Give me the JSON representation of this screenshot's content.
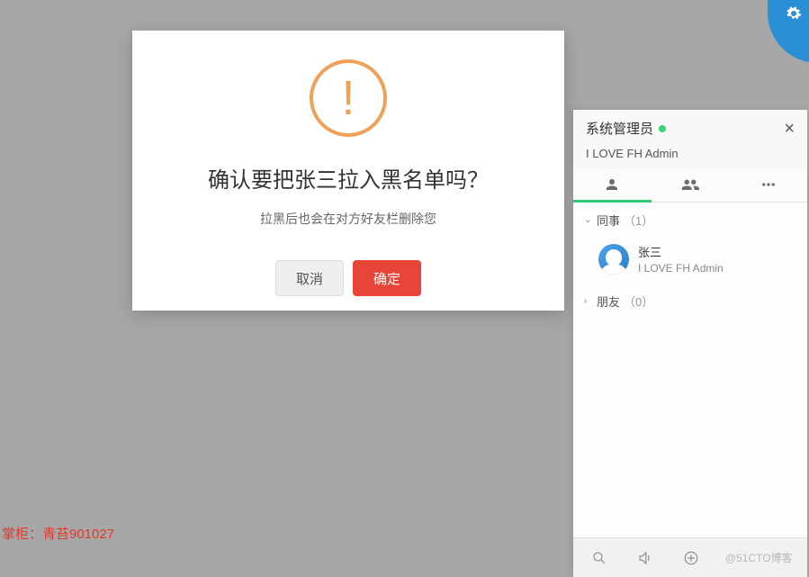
{
  "modal": {
    "title": "确认要把张三拉入黑名单吗？",
    "subtitle": "拉黑后也会在对方好友栏删除您",
    "cancel": "取消",
    "confirm": "确定"
  },
  "panel": {
    "admin_name": "系统管理员",
    "admin_status": "I LOVE FH Admin",
    "groups": [
      {
        "name": "同事",
        "count": "（1）",
        "expanded": true,
        "contacts": [
          {
            "name": "张三",
            "status": "I LOVE FH Admin"
          }
        ]
      },
      {
        "name": "朋友",
        "count": "（0）",
        "expanded": false,
        "contacts": []
      }
    ]
  },
  "owner_label": "掌柜：青苔901027",
  "watermark": "@51CTO博客"
}
